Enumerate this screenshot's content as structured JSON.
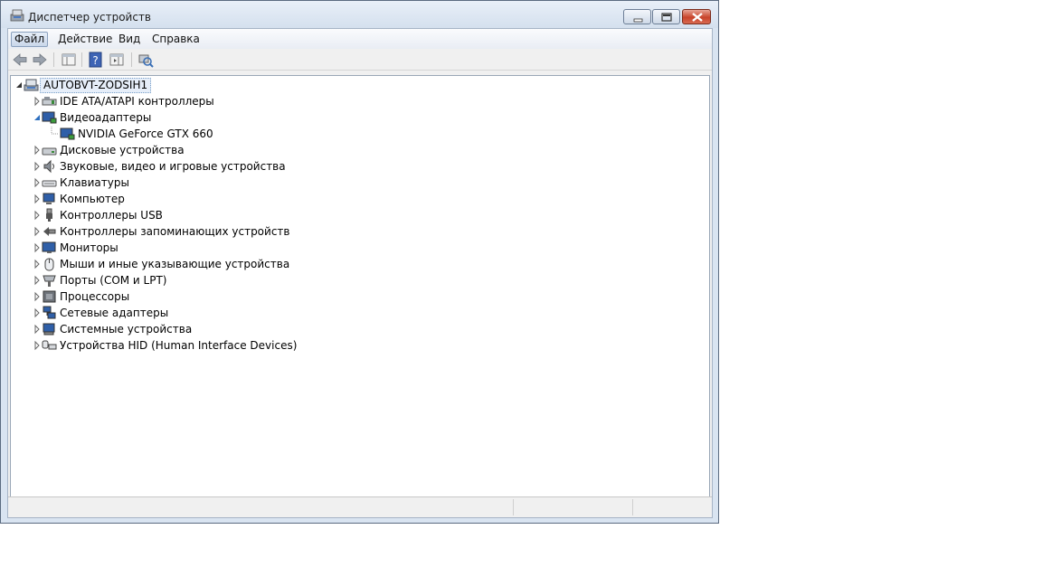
{
  "window": {
    "title": "Диспетчер устройств"
  },
  "menu": [
    {
      "label": "Файл",
      "active": true
    },
    {
      "label": "Действие"
    },
    {
      "label": "Вид"
    },
    {
      "label": "Справка"
    }
  ],
  "toolbar": [
    "back-icon",
    "forward-icon",
    "properties-pane-icon",
    "help-icon",
    "action-pane-icon",
    "scan-hardware-icon"
  ],
  "tree": {
    "root": "AUTOBVT-ZODSIH1",
    "items": [
      {
        "label": "IDE ATA/ATAPI контроллеры",
        "icon": "ide-controller-icon"
      },
      {
        "label": "Видеоадаптеры",
        "icon": "display-adapter-icon",
        "expanded": true,
        "children": [
          {
            "label": "NVIDIA GeForce GTX 660",
            "icon": "gpu-icon"
          }
        ]
      },
      {
        "label": "Дисковые устройства",
        "icon": "disk-drive-icon"
      },
      {
        "label": "Звуковые, видео и игровые устройства",
        "icon": "sound-icon"
      },
      {
        "label": "Клавиатуры",
        "icon": "keyboard-icon"
      },
      {
        "label": "Компьютер",
        "icon": "computer-icon"
      },
      {
        "label": "Контроллеры USB",
        "icon": "usb-icon"
      },
      {
        "label": "Контроллеры запоминающих устройств",
        "icon": "storage-controller-icon"
      },
      {
        "label": "Мониторы",
        "icon": "monitor-icon"
      },
      {
        "label": "Мыши и иные указывающие устройства",
        "icon": "mouse-icon"
      },
      {
        "label": "Порты (COM и LPT)",
        "icon": "port-icon"
      },
      {
        "label": "Процессоры",
        "icon": "processor-icon"
      },
      {
        "label": "Сетевые адаптеры",
        "icon": "network-adapter-icon"
      },
      {
        "label": "Системные устройства",
        "icon": "system-device-icon"
      },
      {
        "label": "Устройства HID (Human Interface Devices)",
        "icon": "hid-icon"
      }
    ]
  },
  "colors": {
    "accent": "#2a6ab5",
    "close": "#c8432a"
  }
}
